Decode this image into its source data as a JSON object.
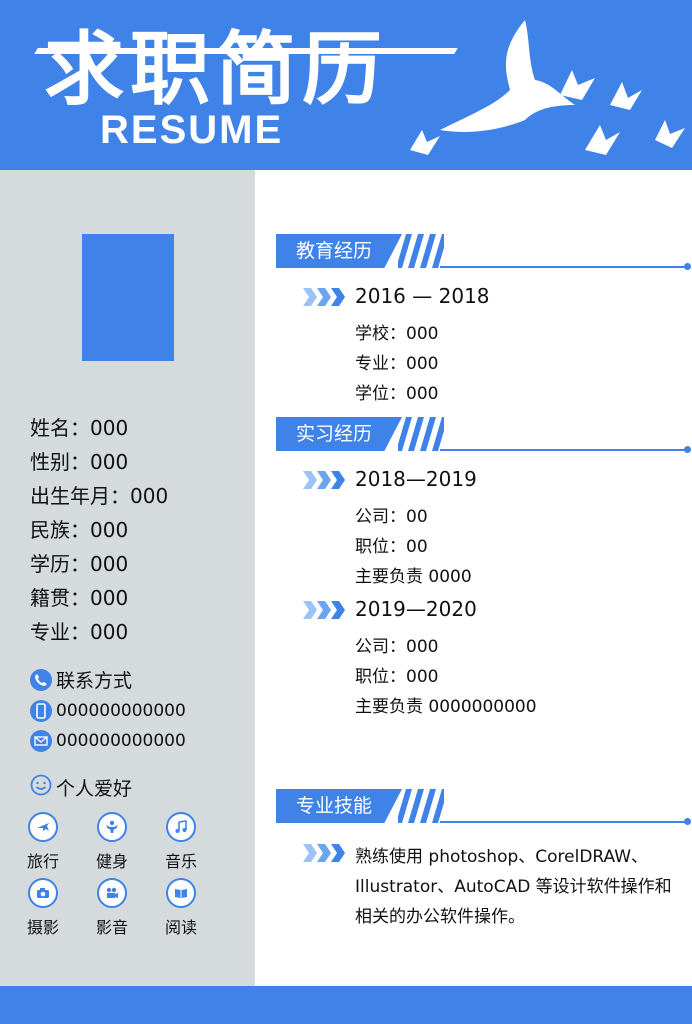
{
  "header": {
    "title_cn": "求职简历",
    "title_en": "RESUME"
  },
  "personal": [
    {
      "label": "姓名：",
      "value": "000"
    },
    {
      "label": "性别：",
      "value": "000"
    },
    {
      "label": "出生年月：",
      "value": "000"
    },
    {
      "label": "民族：",
      "value": "000"
    },
    {
      "label": "学历：",
      "value": "000"
    },
    {
      "label": "籍贯：",
      "value": "000"
    },
    {
      "label": "专业：",
      "value": "000"
    }
  ],
  "contact": {
    "heading": "联系方式",
    "phone": "000000000000",
    "email": "000000000000",
    "heading_icon": "phone-icon",
    "phone_icon": "mobile-icon",
    "email_icon": "mail-icon"
  },
  "hobbies": {
    "heading": "个人爱好",
    "heading_icon": "smiley-icon",
    "items": [
      {
        "label": "旅行",
        "icon": "plane-icon"
      },
      {
        "label": "健身",
        "icon": "fitness-icon"
      },
      {
        "label": "音乐",
        "icon": "music-icon"
      },
      {
        "label": "摄影",
        "icon": "camera-icon"
      },
      {
        "label": "影音",
        "icon": "video-icon"
      },
      {
        "label": "阅读",
        "icon": "book-icon"
      }
    ]
  },
  "education": {
    "title": "教育经历",
    "date": "2016 — 2018",
    "lines": [
      "学校：000",
      "专业：000",
      "学位：000"
    ]
  },
  "internship": {
    "title": "实习经历",
    "entries": [
      {
        "date": "2018—2019",
        "lines": [
          "公司：00",
          "职位：00",
          "主要负责 0000"
        ]
      },
      {
        "date": "2019—2020",
        "lines": [
          "公司：000",
          "职位：000",
          "主要负责 0000000000"
        ]
      }
    ]
  },
  "skills": {
    "title": "专业技能",
    "text": "熟练使用 photoshop、CorelDRAW、Illustrator、AutoCAD 等设计软件操作和相关的办公软件操作。"
  },
  "colors": {
    "accent": "#3f82e8",
    "sidebar": "#d5dadd"
  }
}
